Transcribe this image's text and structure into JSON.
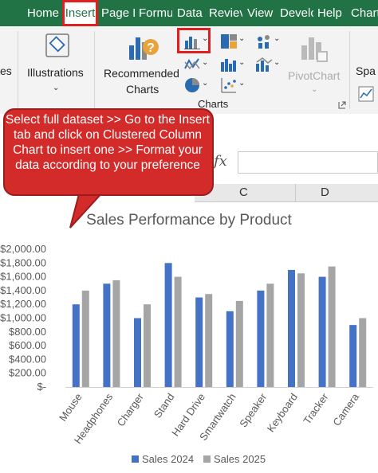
{
  "ribbon_tabs": [
    "Home",
    "Insert",
    "Page L",
    "Formu",
    "Data",
    "Reviev",
    "View",
    "Develc",
    "Help",
    "Chart"
  ],
  "active_tab": "Insert",
  "ribbon": {
    "partial_label": "es",
    "illustrations_label": "Illustrations",
    "recommended_charts_line1": "Recommended",
    "recommended_charts_line2": "Charts",
    "pivotchart_label": "PivotChart",
    "spark_label": "Spa",
    "charts_group_label": "Charts"
  },
  "formula_bar": {
    "fx_symbol": "fx"
  },
  "columns": [
    "C",
    "D"
  ],
  "callout": {
    "text": "Select full dataset >> Go to the Insert tab and click on Clustered Column Chart to insert one >> Format your data according to your preference"
  },
  "colors": {
    "excel_green": "#217346",
    "series_2024": "#4472c4",
    "series_2025": "#a5a5a5",
    "callout_red": "#d32a2a"
  },
  "chart_data": {
    "type": "bar",
    "title": "Sales Performance by Product",
    "categories": [
      "Mouse",
      "Headphones",
      "Charger",
      "Stand",
      "Hard Drive",
      "Smartwatch",
      "Speaker",
      "Keyboard",
      "Tracker",
      "Camera"
    ],
    "series": [
      {
        "name": "Sales 2024",
        "values": [
          1200,
          1500,
          1000,
          1800,
          1300,
          1100,
          1400,
          1700,
          1600,
          900
        ]
      },
      {
        "name": "Sales 2025",
        "values": [
          1400,
          1550,
          1200,
          1600,
          1350,
          1250,
          1500,
          1650,
          1750,
          1000
        ]
      }
    ],
    "ylim": [
      0,
      2000
    ],
    "yticks": [
      "$-",
      "$200.00",
      "$400.00",
      "$600.00",
      "$800.00",
      "$1,000.00",
      "$1,200.00",
      "$1,400.00",
      "$1,600.00",
      "$1,800.00",
      "$2,000.00"
    ],
    "legend_position": "bottom",
    "grid": false
  }
}
